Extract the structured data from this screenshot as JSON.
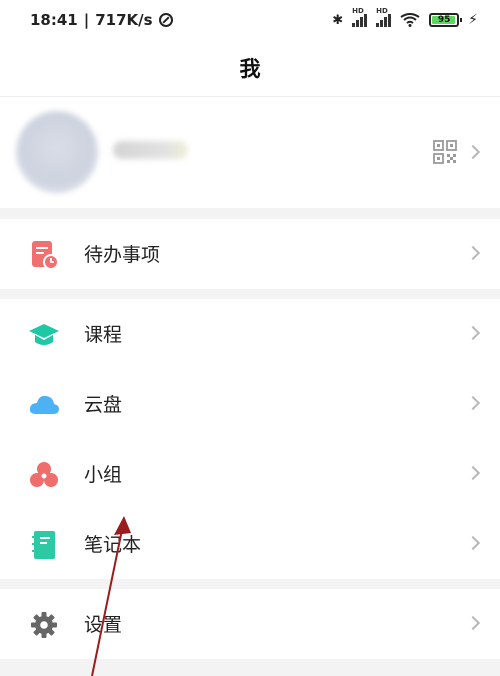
{
  "status_bar": {
    "time": "18:41",
    "speed": "717K/s",
    "signal_label_1": "HD",
    "signal_label_2": "HD",
    "battery": "95"
  },
  "header": {
    "title": "我"
  },
  "profile": {
    "icons": [
      "avatar",
      "qr-code-icon",
      "chevron-right-icon"
    ]
  },
  "groups": [
    {
      "items": [
        {
          "label": "待办事项",
          "icon": "todo-icon",
          "color": "#f07070"
        }
      ]
    },
    {
      "items": [
        {
          "label": "课程",
          "icon": "course-icon",
          "color": "#1ec8a5"
        },
        {
          "label": "云盘",
          "icon": "cloud-icon",
          "color": "#4db1f5"
        },
        {
          "label": "小组",
          "icon": "group-icon",
          "color": "#f06d6d"
        },
        {
          "label": "笔记本",
          "icon": "notebook-icon",
          "color": "#2cc9a5"
        }
      ]
    },
    {
      "items": [
        {
          "label": "设置",
          "icon": "gear-icon",
          "color": "#666666"
        }
      ]
    }
  ],
  "annotation": {
    "color": "#9b1c1c"
  }
}
